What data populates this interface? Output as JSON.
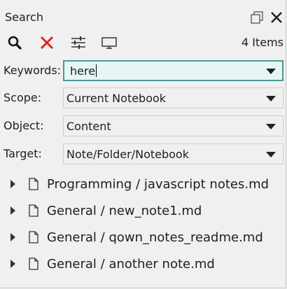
{
  "window": {
    "title": "Search"
  },
  "toolbar": {
    "search_icon": "search-icon",
    "clear_icon": "close-icon",
    "options_icon": "sliders-icon",
    "screen_icon": "monitor-icon",
    "items_count": "4 Items"
  },
  "form": {
    "keywords": {
      "label": "Keywords:",
      "value": "here"
    },
    "scope": {
      "label": "Scope:",
      "value": "Current Notebook"
    },
    "object": {
      "label": "Object:",
      "value": "Content"
    },
    "target": {
      "label": "Target:",
      "value": "Note/Folder/Notebook"
    }
  },
  "results": [
    {
      "text": "Programming / javascript notes.md"
    },
    {
      "text": "General / new_note1.md"
    },
    {
      "text": "General / qown_notes_readme.md"
    },
    {
      "text": "General / another note.md"
    }
  ],
  "colors": {
    "accent_border": "#4a9a92",
    "input_bg": "#e7f6f4",
    "clear_red": "#e02020"
  }
}
